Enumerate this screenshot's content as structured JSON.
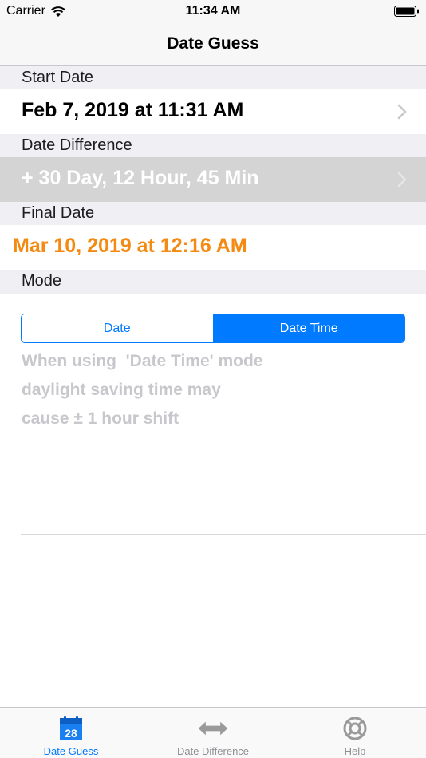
{
  "status_bar": {
    "carrier": "Carrier",
    "time": "11:34 AM"
  },
  "nav": {
    "title": "Date Guess"
  },
  "sections": {
    "start_date": {
      "header": "Start Date",
      "value": "Feb 7, 2019 at 11:31 AM"
    },
    "date_difference": {
      "header": "Date Difference",
      "value": "+ 30 Day, 12 Hour, 45 Min"
    },
    "final_date": {
      "header": "Final Date",
      "value": "Mar 10, 2019 at 12:16 AM"
    },
    "mode": {
      "header": "Mode",
      "segments": [
        "Date",
        "Date Time"
      ],
      "selected": "Date Time",
      "note_lines": [
        "When using  'Date Time' mode",
        "daylight saving time may",
        "cause ± 1 hour shift"
      ]
    }
  },
  "tab_bar": {
    "tabs": [
      {
        "label": "Date Guess",
        "icon": "calendar-icon",
        "active": true,
        "icon_text": "28"
      },
      {
        "label": "Date Difference",
        "icon": "double-arrow-icon",
        "active": false
      },
      {
        "label": "Help",
        "icon": "lifebuoy-icon",
        "active": false
      }
    ]
  },
  "colors": {
    "accent": "#007aff",
    "final_date": "#f48a12",
    "disabled_row": "#d4d4d4",
    "note_text": "#c7c7cc"
  }
}
